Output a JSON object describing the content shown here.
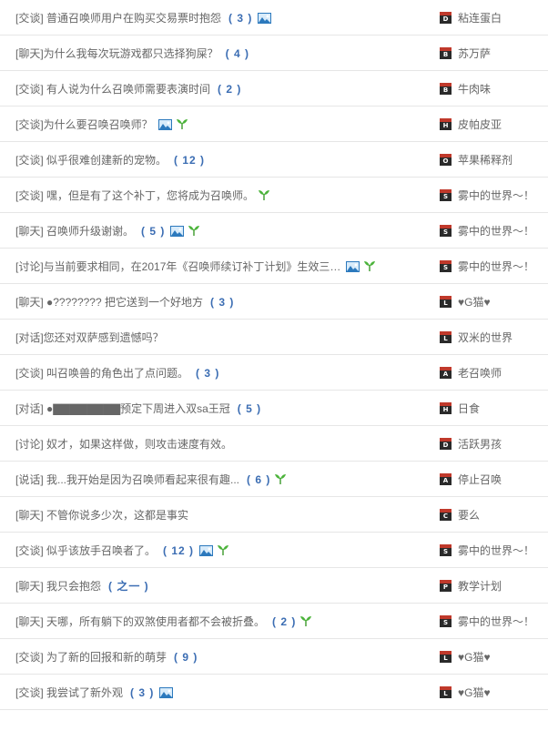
{
  "threads": [
    {
      "title": "[交谈] 普通召唤师用户在购买交易票时抱怨",
      "count": "( 3 )",
      "pic": true,
      "sprout": false,
      "badge": "D",
      "author": "粘连蛋白"
    },
    {
      "title": "[聊天]为什么我每次玩游戏都只选择狗屎？",
      "count": "( 4 )",
      "pic": false,
      "sprout": false,
      "badge": "B",
      "author": "苏万萨"
    },
    {
      "title": "[交谈] 有人说为什么召唤师需要表演时间",
      "count": "( 2 )",
      "pic": false,
      "sprout": false,
      "badge": "B",
      "author": "牛肉味"
    },
    {
      "title": "[交谈]为什么要召唤召唤师？",
      "count": "",
      "pic": true,
      "sprout": true,
      "badge": "H",
      "author": "皮帕皮亚"
    },
    {
      "title": "[交谈] 似乎很难创建新的宠物。",
      "count": "( 12 )",
      "pic": false,
      "sprout": false,
      "badge": "O",
      "author": "苹果稀释剂"
    },
    {
      "title": "[交谈] 嘿，但是有了这个补丁，您将成为召唤师。",
      "count": "",
      "pic": false,
      "sprout": true,
      "badge": "S",
      "author": "雾中的世界〜！"
    },
    {
      "title": "[聊天] 召唤师升级谢谢。",
      "count": "( 5 )",
      "pic": true,
      "sprout": true,
      "badge": "S",
      "author": "雾中的世界〜！"
    },
    {
      "title": "[讨论]与当前要求相同，在2017年《召唤师续订补丁计划》生效三…",
      "count": "",
      "pic": true,
      "sprout": true,
      "badge": "S",
      "author": "雾中的世界〜！"
    },
    {
      "title": "[聊天] ●???????? 把它送到一个好地方",
      "count": "( 3 )",
      "pic": false,
      "sprout": false,
      "badge": "L",
      "author": "♥G猫♥"
    },
    {
      "title": "[对话]您还对双萨感到遗憾吗？",
      "count": "",
      "pic": false,
      "sprout": false,
      "badge": "L",
      "author": "双米的世界"
    },
    {
      "title": "[交谈] 叫召唤兽的角色出了点问题。",
      "count": "( 3 )",
      "pic": false,
      "sprout": false,
      "badge": "A",
      "author": "老召唤师"
    },
    {
      "title": "[对话] ●▇▇▇▇▇▇▇▇预定下周进入双sa王冠",
      "count": "( 5 )",
      "pic": false,
      "sprout": false,
      "badge": "H",
      "author": "日食"
    },
    {
      "title": "[讨论] 奴才，如果这样做，则攻击速度有效。",
      "count": "",
      "pic": false,
      "sprout": false,
      "badge": "D",
      "author": "活跃男孩"
    },
    {
      "title": "[说话] 我...我开始是因为召唤师看起来很有趣...",
      "count": "( 6 )",
      "pic": false,
      "sprout": true,
      "badge": "A",
      "author": "停止召唤"
    },
    {
      "title": "[聊天] 不管你说多少次，这都是事实",
      "count": "",
      "pic": false,
      "sprout": false,
      "badge": "C",
      "author": "要么"
    },
    {
      "title": "[交谈] 似乎该放手召唤者了。",
      "count": "( 12 )",
      "pic": true,
      "sprout": true,
      "badge": "S",
      "author": "雾中的世界〜！"
    },
    {
      "title": "[聊天] 我只会抱怨",
      "count": "( 之一 )",
      "pic": false,
      "sprout": false,
      "badge": "P",
      "author": "教学计划"
    },
    {
      "title": "[聊天] 天哪，所有躺下的双煞使用者都不会被折叠。",
      "count": "( 2 )",
      "pic": false,
      "sprout": true,
      "badge": "S",
      "author": "雾中的世界〜！"
    },
    {
      "title": "[交谈] 为了新的回报和新的萌芽",
      "count": "( 9 )",
      "pic": false,
      "sprout": false,
      "badge": "L",
      "author": "♥G猫♥"
    },
    {
      "title": "[交谈] 我尝试了新外观",
      "count": "( 3 )",
      "pic": true,
      "sprout": false,
      "badge": "L",
      "author": "♥G猫♥"
    }
  ],
  "colors": {
    "title_text": "#666666",
    "count_text": "#3b6db3",
    "divider": "#e6e6e6",
    "badge_bg": "#2a2a2a",
    "badge_top": "#c0392b",
    "image_icon_border": "#2c79bd",
    "sprout_icon": "#3a9a2a"
  },
  "icons": {
    "image_icon": "image-attachment-icon",
    "sprout_icon": "new-sprout-icon",
    "rank_badge": "rank-badge-icon"
  }
}
